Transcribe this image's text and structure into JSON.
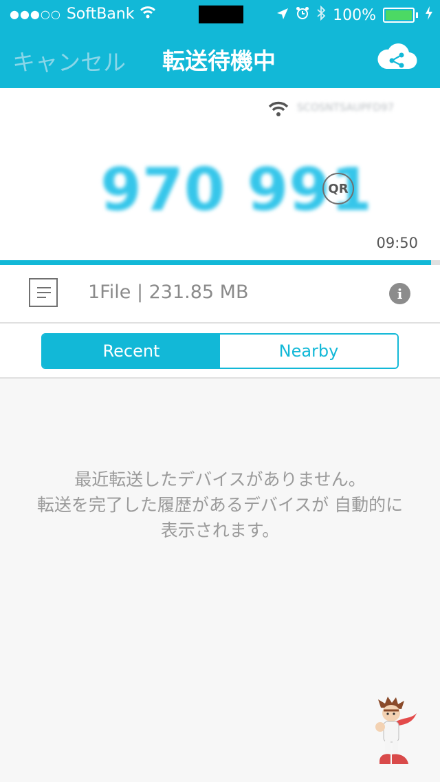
{
  "status_bar": {
    "signal": "●●●○○",
    "carrier": "SoftBank",
    "battery": "100%"
  },
  "header": {
    "cancel_label": "キャンセル",
    "title": "転送待機中",
    "share_icon": "cloud-share-icon"
  },
  "transfer": {
    "ssid": "SCOSNTSAUPFD97",
    "code": "970 991",
    "qr_label": "QR",
    "timer": "09:50",
    "progress": 0.98
  },
  "file_info": {
    "text": "1File | 231.85 MB",
    "info_label": "i"
  },
  "tabs": [
    {
      "label": "Recent",
      "active": true
    },
    {
      "label": "Nearby",
      "active": false
    }
  ],
  "empty_state": {
    "line1": "最近転送したデバイスがありません。",
    "line2": "転送を完了した履歴があるデバイスが 自動的に",
    "line3": "表示されます。"
  },
  "colors": {
    "accent": "#12b8d7",
    "background": "#f7f7f7"
  }
}
